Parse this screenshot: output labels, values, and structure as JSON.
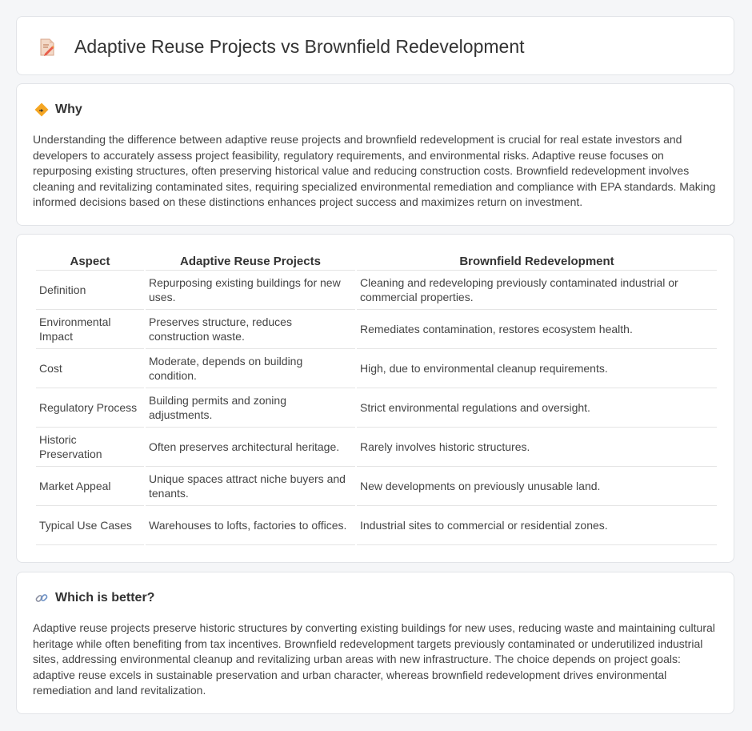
{
  "header": {
    "title": "Adaptive Reuse Projects vs Brownfield Redevelopment",
    "icon": "document-pencil-icon"
  },
  "why": {
    "heading": "Why",
    "icon": "diamond-sign-icon",
    "text": "Understanding the difference between adaptive reuse projects and brownfield redevelopment is crucial for real estate investors and developers to accurately assess project feasibility, regulatory requirements, and environmental risks. Adaptive reuse focuses on repurposing existing structures, often preserving historical value and reducing construction costs. Brownfield redevelopment involves cleaning and revitalizing contaminated sites, requiring specialized environmental remediation and compliance with EPA standards. Making informed decisions based on these distinctions enhances project success and maximizes return on investment."
  },
  "table": {
    "headers": [
      "Aspect",
      "Adaptive Reuse Projects",
      "Brownfield Redevelopment"
    ],
    "rows": [
      [
        "Definition",
        "Repurposing existing buildings for new uses.",
        "Cleaning and redeveloping previously contaminated industrial or commercial properties."
      ],
      [
        "Environmental Impact",
        "Preserves structure, reduces construction waste.",
        "Remediates contamination, restores ecosystem health."
      ],
      [
        "Cost",
        "Moderate, depends on building condition.",
        "High, due to environmental cleanup requirements."
      ],
      [
        "Regulatory Process",
        "Building permits and zoning adjustments.",
        "Strict environmental regulations and oversight."
      ],
      [
        "Historic Preservation",
        "Often preserves architectural heritage.",
        "Rarely involves historic structures."
      ],
      [
        "Market Appeal",
        "Unique spaces attract niche buyers and tenants.",
        "New developments on previously unusable land."
      ],
      [
        "Typical Use Cases",
        "Warehouses to lofts, factories to offices.",
        "Industrial sites to commercial or residential zones."
      ]
    ]
  },
  "better": {
    "heading": "Which is better?",
    "icon": "link-icon",
    "text": "Adaptive reuse projects preserve historic structures by converting existing buildings for new uses, reducing waste and maintaining cultural heritage while often benefiting from tax incentives. Brownfield redevelopment targets previously contaminated or underutilized industrial sites, addressing environmental cleanup and revitalizing urban areas with new infrastructure. The choice depends on project goals: adaptive reuse excels in sustainable preservation and urban character, whereas brownfield redevelopment drives environmental remediation and land revitalization."
  }
}
